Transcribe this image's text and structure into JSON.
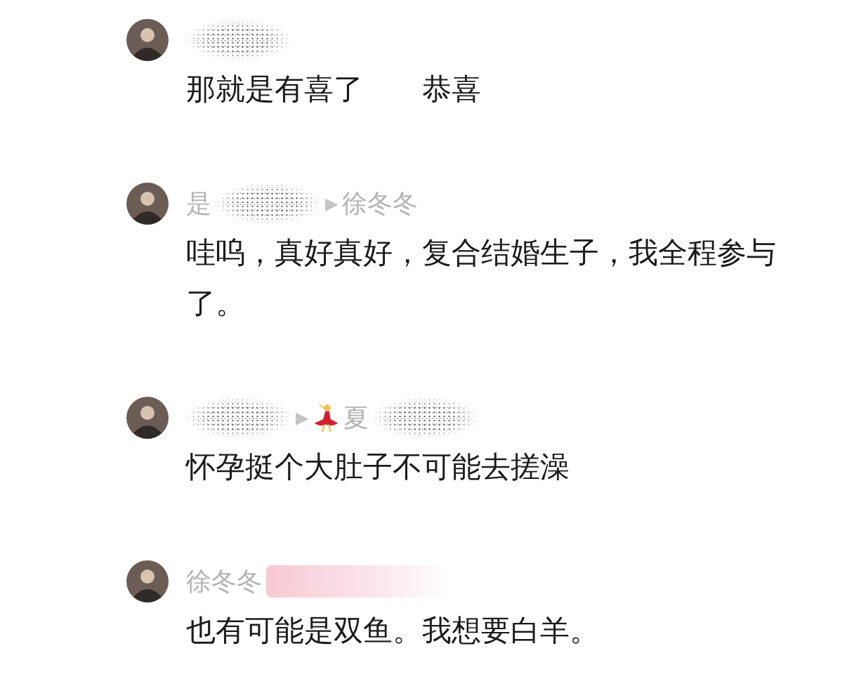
{
  "comments": [
    {
      "header": [
        {
          "kind": "redacted"
        }
      ],
      "lines": [
        "那就是有喜了　　恭喜"
      ]
    },
    {
      "header": [
        {
          "kind": "name",
          "text": "是"
        },
        {
          "kind": "redacted"
        },
        {
          "kind": "arrow",
          "text": "▶"
        },
        {
          "kind": "name",
          "text": "徐冬冬"
        }
      ],
      "lines": [
        "哇呜，真好真好，复合结婚生子，我全程参与了。"
      ]
    },
    {
      "header": [
        {
          "kind": "redacted"
        },
        {
          "kind": "arrow",
          "text": "▶"
        },
        {
          "kind": "dancer"
        },
        {
          "kind": "name",
          "text": "夏"
        },
        {
          "kind": "redacted"
        }
      ],
      "lines": [
        "怀孕挺个大肚子不可能去搓澡"
      ]
    },
    {
      "header": [
        {
          "kind": "name",
          "text": "徐冬冬"
        },
        {
          "kind": "badge"
        }
      ],
      "lines": [
        "也有可能是双鱼。我想要白羊。"
      ]
    }
  ]
}
